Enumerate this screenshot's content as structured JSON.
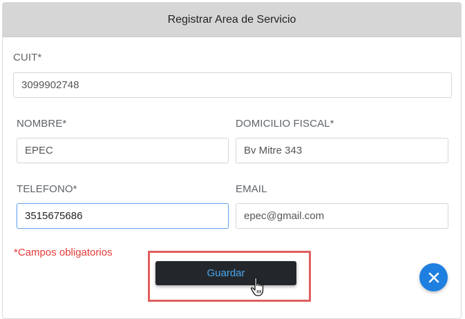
{
  "modal": {
    "title": "Registrar Area de Servicio"
  },
  "fields": {
    "cuit": {
      "label": "CUIT*",
      "value": "3099902748"
    },
    "nombre": {
      "label": "NOMBRE*",
      "value": "EPEC"
    },
    "domicilio": {
      "label": "DOMICILIO FISCAL*",
      "value": "Bv Mitre 343"
    },
    "telefono": {
      "label": "TELEFONO*",
      "value": "3515675686"
    },
    "email": {
      "label": "EMAIL",
      "value": "epec@gmail.com"
    }
  },
  "form": {
    "required_note": "*Campos obligatorios",
    "save_label": "Guardar"
  },
  "icons": {
    "close": "close-icon",
    "cursor": "hand-pointer-icon"
  },
  "colors": {
    "header_bg": "#d6d6d6",
    "button_bg": "#23272c",
    "button_text": "#4aa8ef",
    "required": "#e53935",
    "highlight": "#e15e5e",
    "fab": "#1f7fe0"
  }
}
